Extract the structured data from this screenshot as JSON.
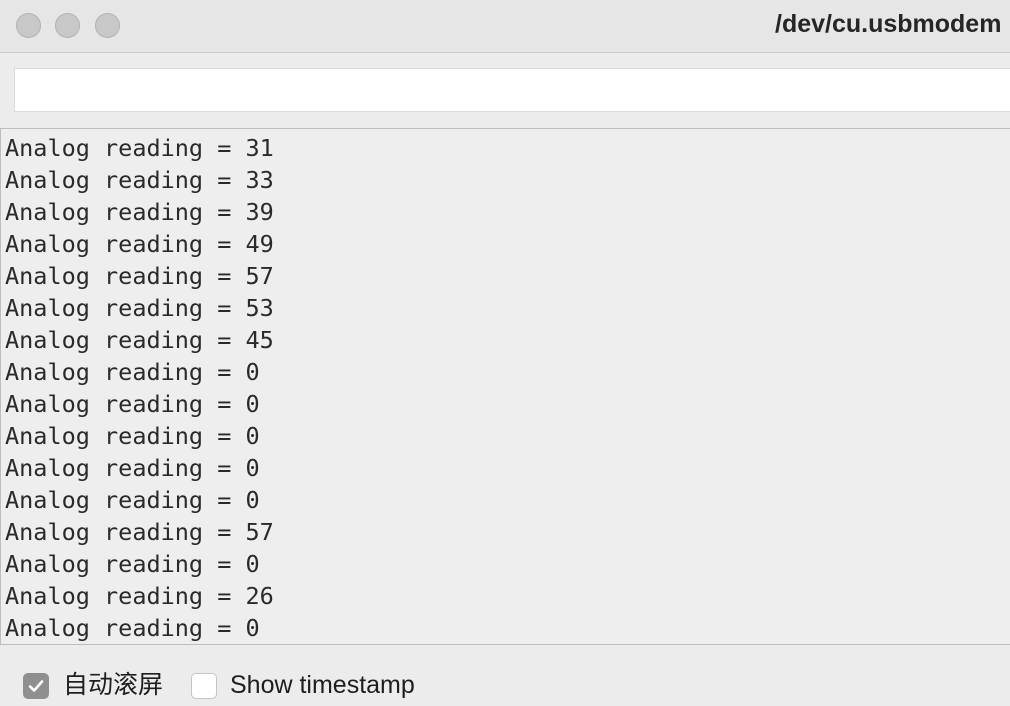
{
  "window": {
    "title": "/dev/cu.usbmodem"
  },
  "send": {
    "value": "",
    "placeholder": ""
  },
  "output": {
    "lines": [
      "Analog reading = 31",
      "Analog reading = 33",
      "Analog reading = 39",
      "Analog reading = 49",
      "Analog reading = 57",
      "Analog reading = 53",
      "Analog reading = 45",
      "Analog reading = 0",
      "Analog reading = 0",
      "Analog reading = 0",
      "Analog reading = 0",
      "Analog reading = 0",
      "Analog reading = 57",
      "Analog reading = 0",
      "Analog reading = 26",
      "Analog reading = 0"
    ]
  },
  "footer": {
    "autoscroll": {
      "label": "自动滚屏",
      "checked": true
    },
    "timestamp": {
      "label": "Show timestamp",
      "checked": false
    }
  },
  "colors": {
    "window_bg": "#ececec",
    "traffic_light_inactive": "#c8c8c8",
    "checkbox_checked": "#8f8f8f"
  },
  "icons": {
    "traffic_lights": [
      "close-button-icon",
      "minimize-button-icon",
      "zoom-button-icon"
    ],
    "checkmark": "checkmark-icon"
  }
}
